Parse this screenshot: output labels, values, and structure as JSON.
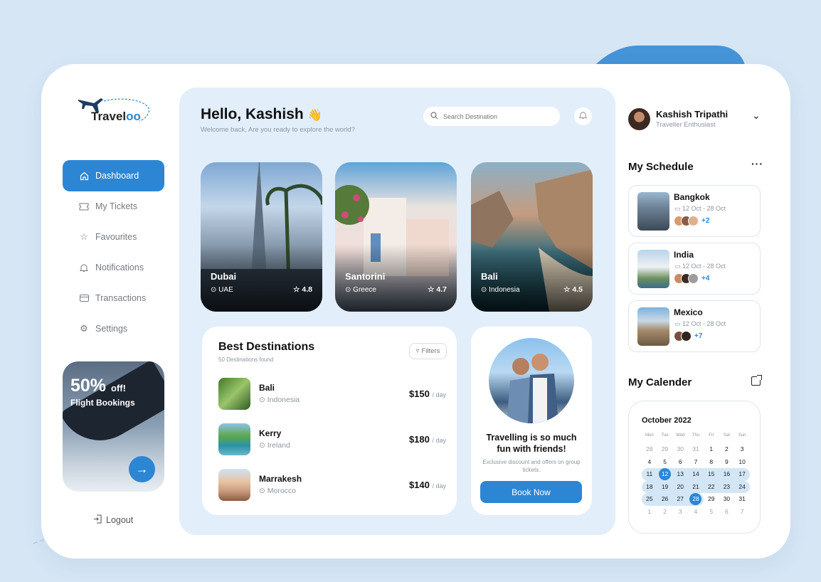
{
  "brand": {
    "name_prefix": "Travel",
    "name_suffix": "oo",
    "accent": "#2d86d3"
  },
  "sidebar": {
    "items": [
      {
        "label": "Dashboard",
        "icon": "home-icon",
        "active": true
      },
      {
        "label": "My Tickets",
        "icon": "ticket-icon"
      },
      {
        "label": "Favourites",
        "icon": "star-icon"
      },
      {
        "label": "Notifications",
        "icon": "bell-icon"
      },
      {
        "label": "Transactions",
        "icon": "card-icon"
      },
      {
        "label": "Settings",
        "icon": "gear-icon"
      }
    ],
    "promo": {
      "percent": "50%",
      "off": "off!",
      "subtitle": "Flight Bookings"
    },
    "logout": "Logout"
  },
  "header": {
    "greeting": "Hello, Kashish",
    "wave": "👋",
    "subtitle": "Welcome back, Are you ready to explore the world?",
    "search_placeholder": "Search Destination"
  },
  "destinations": [
    {
      "name": "Dubai",
      "location": "UAE",
      "rating": "4.8"
    },
    {
      "name": "Santorini",
      "location": "Greece",
      "rating": "4.7"
    },
    {
      "name": "Bali",
      "location": "Indonesia",
      "rating": "4.5"
    }
  ],
  "best": {
    "title": "Best Destinations",
    "subtitle": "50 Destinations found",
    "filters_label": "Filters",
    "rows": [
      {
        "name": "Bali",
        "location": "Indonesia",
        "price": "$150",
        "unit": "/ day"
      },
      {
        "name": "Kerry",
        "location": "Ireland",
        "price": "$180",
        "unit": "/ day"
      },
      {
        "name": "Marrakesh",
        "location": "Morocco",
        "price": "$140",
        "unit": "/ day"
      }
    ]
  },
  "promo_card": {
    "title": "Travelling is so much fun with friends!",
    "text": "Exclusive discount and offers on group tickets.",
    "button": "Book Now"
  },
  "profile": {
    "name": "Kashish Tripathi",
    "role": "Traveller Enthusiast"
  },
  "schedule": {
    "title": "My Schedule",
    "items": [
      {
        "place": "Bangkok",
        "dates": "12 Oct - 28 Oct",
        "more": "+2"
      },
      {
        "place": "India",
        "dates": "12 Oct - 28 Oct",
        "more": "+4"
      },
      {
        "place": "Mexico",
        "dates": "12 Oct - 28 Oct",
        "more": "+7"
      }
    ]
  },
  "calendar": {
    "title": "My Calender",
    "month": "October 2022",
    "weekdays": [
      "Mon",
      "Tue",
      "Wed",
      "Thu",
      "Fri",
      "Sat",
      "Sun"
    ],
    "days": [
      "28",
      "29",
      "30",
      "31",
      "1",
      "2",
      "3",
      "4",
      "5",
      "6",
      "7",
      "8",
      "9",
      "10",
      "11",
      "12",
      "13",
      "14",
      "15",
      "16",
      "17",
      "18",
      "19",
      "20",
      "21",
      "22",
      "23",
      "24",
      "25",
      "26",
      "27",
      "28",
      "29",
      "30",
      "31",
      "1",
      "2",
      "3",
      "4",
      "5",
      "6",
      "7"
    ],
    "selected": [
      "12",
      "28"
    ]
  }
}
